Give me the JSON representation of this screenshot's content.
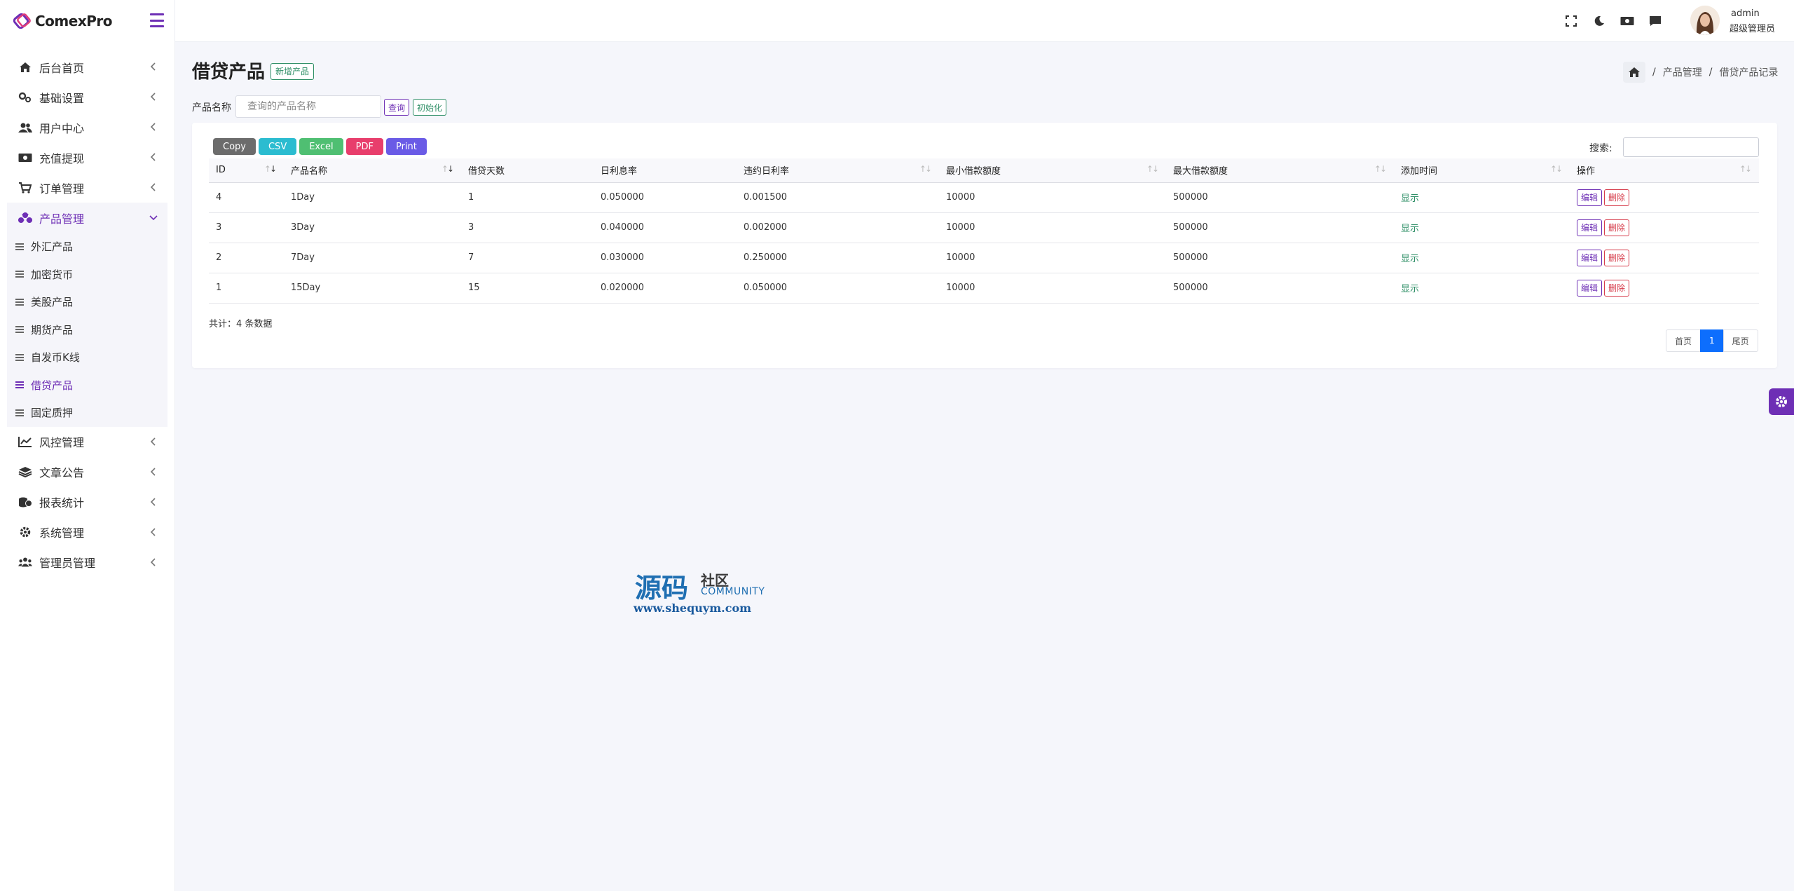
{
  "brand": {
    "name": "ComexPro"
  },
  "sidebar": {
    "items": [
      {
        "label": "后台首页"
      },
      {
        "label": "基础设置"
      },
      {
        "label": "用户中心"
      },
      {
        "label": "充值提现"
      },
      {
        "label": "订单管理"
      },
      {
        "label": "产品管理"
      },
      {
        "label": "风控管理"
      },
      {
        "label": "文章公告"
      },
      {
        "label": "报表统计"
      },
      {
        "label": "系统管理"
      },
      {
        "label": "管理员管理"
      }
    ],
    "subitems": [
      {
        "label": "外汇产品"
      },
      {
        "label": "加密货币"
      },
      {
        "label": "美股产品"
      },
      {
        "label": "期货产品"
      },
      {
        "label": "自发币K线"
      },
      {
        "label": "借贷产品"
      },
      {
        "label": "固定质押"
      }
    ]
  },
  "user": {
    "name": "admin",
    "role": "超级管理员"
  },
  "page": {
    "title": "借贷产品",
    "new_label": "新增产品"
  },
  "breadcrumb": {
    "level1": "产品管理",
    "level2": "借贷产品记录",
    "sep": "/"
  },
  "filter": {
    "label": "产品名称",
    "placeholder": "查询的产品名称",
    "query_label": "查询",
    "reset_label": "初始化"
  },
  "export": {
    "copy": "Copy",
    "csv": "CSV",
    "excel": "Excel",
    "pdf": "PDF",
    "print": "Print"
  },
  "search": {
    "label": "搜索:"
  },
  "table": {
    "columns": [
      "ID",
      "产品名称",
      "借贷天数",
      "日利息率",
      "违约日利率",
      "最小借款额度",
      "最大借款额度",
      "添加时间",
      "操作"
    ],
    "rows": [
      {
        "id": "4",
        "name": "1Day",
        "days": "1",
        "rate": "0.050000",
        "penalty": "0.001500",
        "min": "10000",
        "max": "500000",
        "status": "显示"
      },
      {
        "id": "3",
        "name": "3Day",
        "days": "3",
        "rate": "0.040000",
        "penalty": "0.002000",
        "min": "10000",
        "max": "500000",
        "status": "显示"
      },
      {
        "id": "2",
        "name": "7Day",
        "days": "7",
        "rate": "0.030000",
        "penalty": "0.250000",
        "min": "10000",
        "max": "500000",
        "status": "显示"
      },
      {
        "id": "1",
        "name": "15Day",
        "days": "15",
        "rate": "0.020000",
        "penalty": "0.050000",
        "min": "10000",
        "max": "500000",
        "status": "显示"
      }
    ],
    "edit_label": "编辑",
    "delete_label": "删除"
  },
  "summary": {
    "total": "共计：4 条数据"
  },
  "pager": {
    "first": "首页",
    "current": "1",
    "last": "尾页"
  },
  "watermark": {
    "big": "源码",
    "small": "社区",
    "community": "COMMUNITY",
    "url": "www.shequym.com"
  },
  "colors": {
    "accent": "#6e2fb5",
    "success": "#2f8f67",
    "danger": "#d63b4a",
    "primary": "#0d6efd",
    "copy": "#6c6c6c",
    "csv": "#2bbcd0",
    "excel": "#4fbf72",
    "pdf": "#e83e6c",
    "print": "#6a5be6"
  }
}
